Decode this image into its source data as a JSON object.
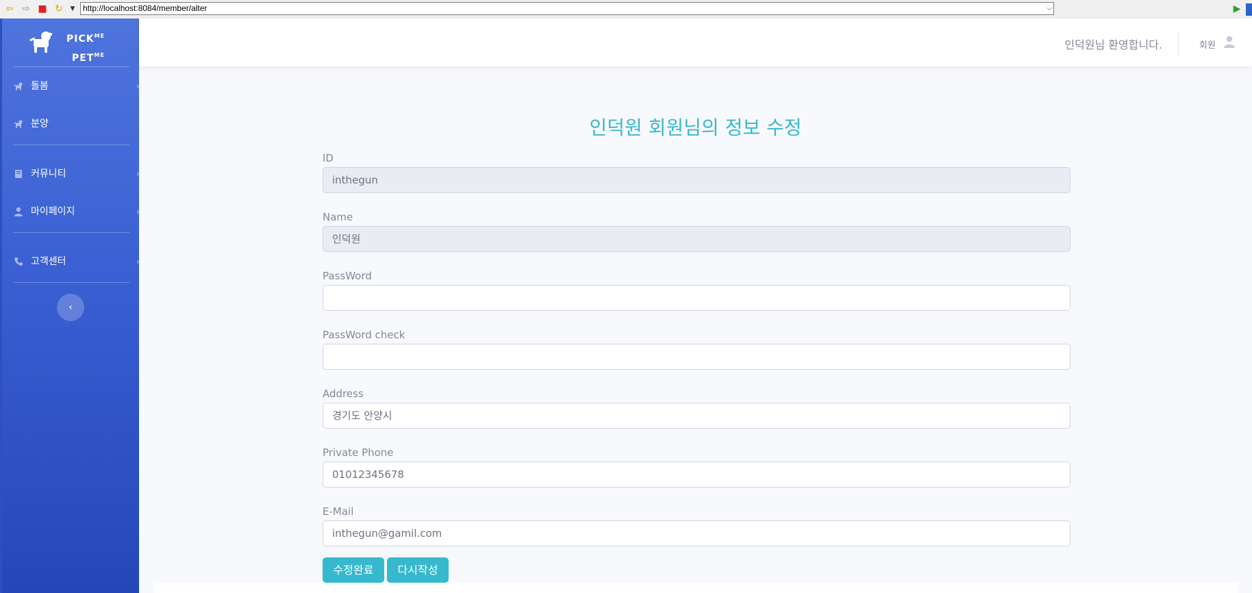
{
  "browser": {
    "url": "http://localhost:8084/member/alter"
  },
  "brand": {
    "line1": "PICK",
    "line1_sup": "ME",
    "line2": "PET",
    "line2_sup": "ME"
  },
  "sidebar": {
    "items": [
      {
        "label": "돌봄",
        "icon": "dog-icon"
      },
      {
        "label": "분양",
        "icon": "dog-icon"
      },
      {
        "label": "커뮤니티",
        "icon": "book-icon"
      },
      {
        "label": "마이페이지",
        "icon": "user-icon"
      },
      {
        "label": "고객센터",
        "icon": "phone-icon"
      }
    ]
  },
  "topbar": {
    "welcome": "인덕원님 환영합니다.",
    "role": "회원"
  },
  "form": {
    "title": "인덕원 회원님의 정보 수정",
    "id_label": "ID",
    "id_value": "inthegun",
    "name_label": "Name",
    "name_value": "인덕원",
    "password_label": "PassWord",
    "password_value": "",
    "password_check_label": "PassWord check",
    "password_check_value": "",
    "address_label": "Address",
    "address_value": "경기도 안양시",
    "phone_label": "Private Phone",
    "phone_value": "01012345678",
    "email_label": "E-Mail",
    "email_value": "inthegun@gamil.com",
    "submit_label": "수정완료",
    "reset_label": "다시작성"
  },
  "colors": {
    "accent": "#36b9cc",
    "sidebar_top": "#4f74dd",
    "sidebar_bottom": "#2447b8"
  }
}
